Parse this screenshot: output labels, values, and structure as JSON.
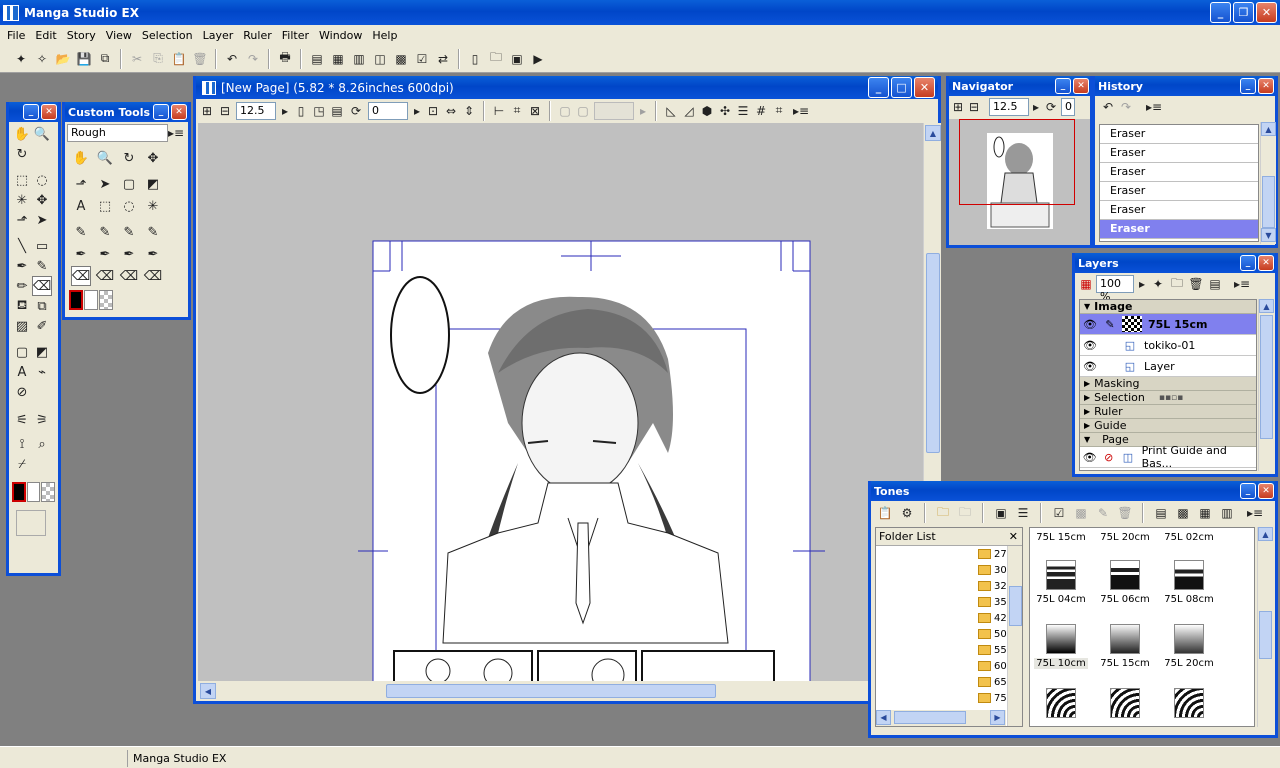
{
  "app": {
    "title": "Manga Studio EX",
    "window_buttons": [
      "_",
      "❐",
      "✕"
    ]
  },
  "menu": [
    "File",
    "Edit",
    "Story",
    "View",
    "Selection",
    "Layer",
    "Ruler",
    "Filter",
    "Window",
    "Help"
  ],
  "tools_panel": {
    "title": ""
  },
  "custom_tools": {
    "title": "Custom Tools",
    "preset": "Rough"
  },
  "document": {
    "title": "[New Page] (5.82 * 8.26inches 600dpi)",
    "zoom": "12.5",
    "rotation": "0"
  },
  "navigator": {
    "title": "Navigator",
    "zoom": "12.5",
    "rotation": "0"
  },
  "history": {
    "title": "History",
    "items": [
      "Eraser",
      "Eraser",
      "Eraser",
      "Eraser",
      "Eraser",
      "Eraser"
    ]
  },
  "layers": {
    "title": "Layers",
    "opacity": "100 %",
    "image_group": "Image",
    "rows": [
      "75L 15cm",
      "tokiko-01",
      "Layer"
    ],
    "groups": [
      "Masking",
      "Selection",
      "Ruler",
      "Guide",
      "Page"
    ],
    "page_row": "Print Guide and Bas..."
  },
  "tones": {
    "title": "Tones",
    "folder_list_label": "Folder List",
    "folders": [
      "27",
      "30",
      "32",
      "35",
      "42",
      "50",
      "55",
      "60",
      "65",
      "75"
    ],
    "labels_row1": [
      "75L 15cm",
      "75L 20cm",
      "75L 02cm"
    ],
    "tiles": [
      {
        "label": "75L 04cm"
      },
      {
        "label": "75L 06cm"
      },
      {
        "label": "75L 08cm"
      },
      {
        "label": "75L 10cm"
      },
      {
        "label": "75L 15cm"
      },
      {
        "label": "75L 20cm"
      }
    ],
    "selected": "75L 10cm"
  },
  "status": {
    "text": "Manga Studio EX"
  }
}
